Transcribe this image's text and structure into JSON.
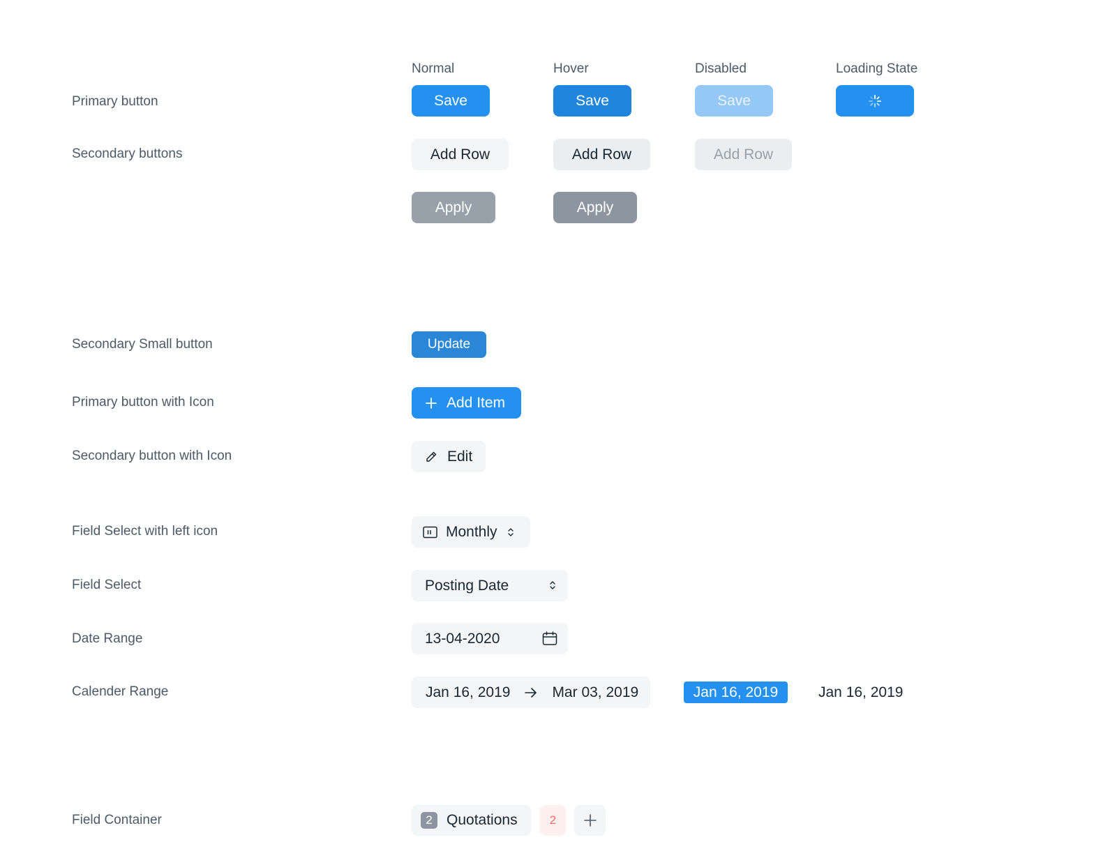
{
  "columns": {
    "normal": "Normal",
    "hover": "Hover",
    "disabled": "Disabled",
    "loading": "Loading State"
  },
  "rows": {
    "primary_button": "Primary button",
    "secondary_buttons": "Secondary buttons",
    "secondary_small_button": "Secondary Small button",
    "primary_button_with_icon": "Primary button with Icon",
    "secondary_button_with_icon": "Secondary button with Icon",
    "field_select_left_icon": "Field Select with left icon",
    "field_select": "Field Select",
    "date_range": "Date Range",
    "calender_range": "Calender Range",
    "field_container": "Field Container"
  },
  "buttons": {
    "save": "Save",
    "add_row": "Add Row",
    "apply": "Apply",
    "update": "Update",
    "add_item": "Add Item",
    "edit": "Edit"
  },
  "fields": {
    "monthly": "Monthly",
    "posting_date": "Posting Date",
    "date_value": "13-04-2020",
    "range_start": "Jan 16, 2019",
    "range_end": "Mar 03, 2019",
    "selected_date": "Jan 16, 2019",
    "plain_date": "Jan 16, 2019"
  },
  "field_container": {
    "count": "2",
    "label": "Quotations",
    "alert_count": "2"
  },
  "icons": {
    "add": "plus-icon",
    "edit": "pencil-icon",
    "select_left": "panel-icon",
    "select_caret": "chevron-updown-icon",
    "calendar": "calendar-icon",
    "arrow": "arrow-right-icon",
    "loading": "spinner-icon"
  },
  "colors": {
    "primary": "#2490ef",
    "primary_disabled": "#95c8f6",
    "secondary_bg": "#f4f5f6",
    "gray_button": "#98a1a9",
    "alert_bg": "#fff0f0",
    "alert_text": "#f56b6b"
  }
}
